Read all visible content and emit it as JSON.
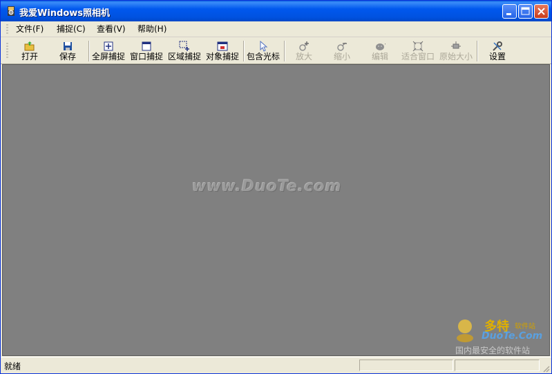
{
  "window": {
    "title": "我爱Windows照相机"
  },
  "menu": [
    {
      "label": "文件(F)"
    },
    {
      "label": "捕捉(C)"
    },
    {
      "label": "查看(V)"
    },
    {
      "label": "帮助(H)"
    }
  ],
  "toolbar": {
    "open": "打开",
    "save": "保存",
    "fullscreen": "全屏捕捉",
    "window_capture": "窗口捕捉",
    "region_capture": "区域捕捉",
    "object_capture": "对象捕捉",
    "include_cursor": "包含光标",
    "zoom_in": "放大",
    "zoom_out": "缩小",
    "edit": "编辑",
    "fit_window": "适合窗口",
    "original_size": "原始大小",
    "settings": "设置"
  },
  "client": {
    "watermark": "www.DuoTe.com",
    "logo_cn": "多特",
    "logo_sub": "软件站",
    "logo_en": "DuoTe.Com",
    "logo_slogan": "国内最安全的软件站"
  },
  "status": {
    "text": "就绪"
  },
  "colors": {
    "titlebar": "#0054e3",
    "client_bg": "#808080",
    "chrome": "#ece9d8"
  }
}
